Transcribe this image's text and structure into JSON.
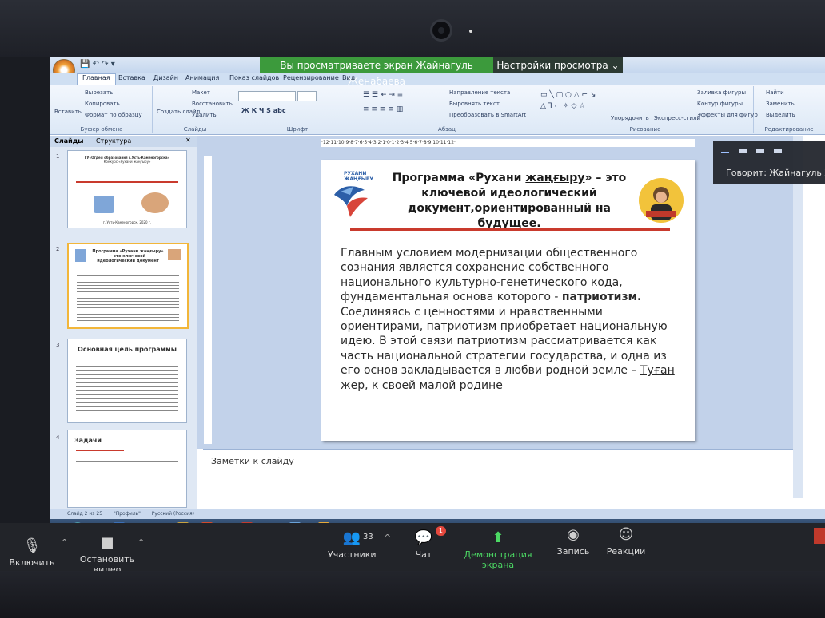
{
  "zoom": {
    "share_banner": "Вы просматриваете экран Жайнагуль Женабаева",
    "view_settings": "Настройки просмотра ⌄",
    "speaking": "Говорит: Жайнагуль Ж",
    "toolbar": {
      "mute": "Включить звук",
      "video": "Остановить видео",
      "participants": "Участники",
      "participants_count": "33",
      "chat": "Чат",
      "chat_badge": "1",
      "share": "Демонстрация экрана",
      "record": "Запись",
      "reactions": "Реакции"
    }
  },
  "ppt": {
    "tabs": [
      "Главная",
      "Вставка",
      "Дизайн",
      "Анимация",
      "Показ слайдов",
      "Рецензирование",
      "Вид"
    ],
    "clipboard": {
      "paste": "Вставить",
      "cut": "Вырезать",
      "copy": "Копировать",
      "format": "Формат по образцу",
      "group": "Буфер обмена"
    },
    "slides_group": {
      "new": "Создать слайд",
      "layout": "Макет",
      "reset": "Восстановить",
      "delete": "Удалить",
      "group": "Слайды"
    },
    "font_group": "Шрифт",
    "para_group": {
      "direction": "Направление текста",
      "align": "Выровнять текст",
      "smartart": "Преобразовать в SmartArt",
      "group": "Абзац"
    },
    "drawing_group": {
      "arrange": "Упорядочить",
      "styles": "Экспресс-стили",
      "fill": "Заливка фигуры",
      "outline": "Контур фигуры",
      "effects": "Эффекты для фигур",
      "group": "Рисование"
    },
    "editing_group": {
      "find": "Найти",
      "replace": "Заменить",
      "select": "Выделить",
      "group": "Редактирование"
    },
    "pane_tabs": {
      "slides": "Слайды",
      "outline": "Структура"
    },
    "ruler": "·12·11·10·9·8·7·6·5·4·3·2·1·0·1·2·3·4·5·6·7·8·9·10·11·12·",
    "thumbs": {
      "t1": {
        "line1": "ГУ«Отдел образования г.Усть-Каменогорска»",
        "line2": "Конкурс «Рухани жаңғыру»",
        "foot": "г. Усть-Каменогорск, 2020 г."
      },
      "t2": {
        "title": "Программа «Рухани жаңғыру» – это ключевой идеологический документ"
      },
      "t3": {
        "title": "Основная цель программы"
      },
      "t4": {
        "title": "Задачи"
      }
    },
    "slide": {
      "title_pre": "Программа «Рухани ",
      "title_ul": "жаңғыру",
      "title_post": "» – это ключевой идеологический документ,ориентированный на будущее.",
      "logo_text": "РУХАНИ ЖАҢҒЫРУ",
      "body_1": "Главным условием модернизации общественного сознания является сохранение собственного национального культурно-генетического кода, фундаментальная основа которого - ",
      "body_bold": "патриотизм.",
      "body_2": " Соединяясь с ценностями и нравственными ориентирами, патриотизм приобретает национальную идею. В этой связи патриотизм рассматривается как часть национальной стратегии государства, и одна из его основ закладывается в любви родной земле – ",
      "body_ul": "Туған жер",
      "body_3": ", к своей малой родине"
    },
    "notes": "Заметки к слайду",
    "status": {
      "slide": "Слайд 2 из 25",
      "theme": "\"Профиль\"",
      "lang": "Русский (Россия)"
    }
  }
}
